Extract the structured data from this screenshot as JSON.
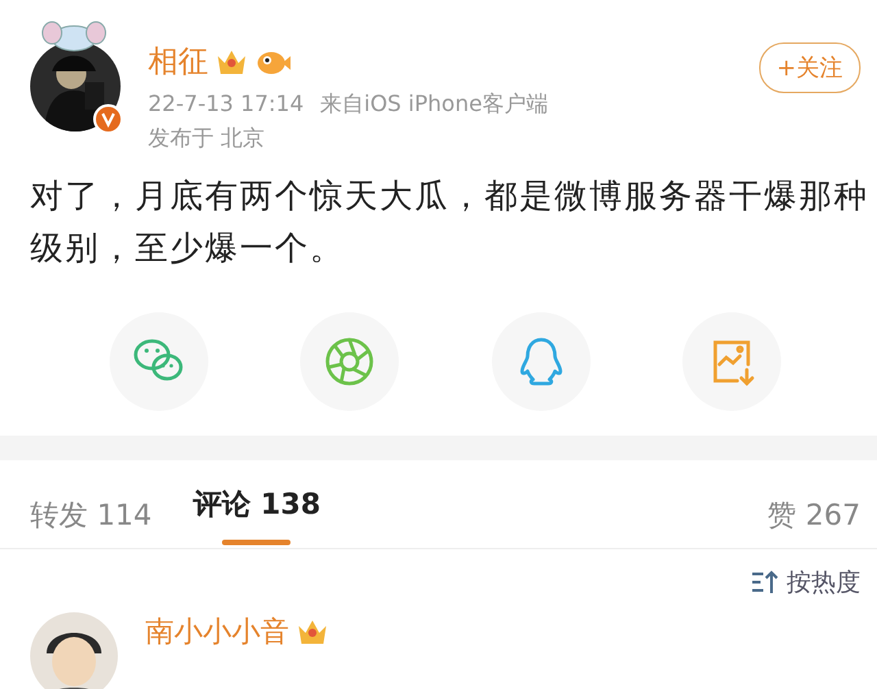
{
  "post": {
    "author": {
      "name": "相征",
      "verified": true
    },
    "time": "22-7-13 17:14",
    "source": "来自iOS iPhone客户端",
    "location": "发布于 北京",
    "follow_button": "+关注",
    "text": "对了，月底有两个惊天大瓜，都是微博服务器干爆那种级别，至少爆一个。"
  },
  "share": [
    {
      "kind": "wechat"
    },
    {
      "kind": "moments"
    },
    {
      "kind": "qq"
    },
    {
      "kind": "save-image"
    }
  ],
  "tabs": [
    {
      "label": "转发",
      "count": "114",
      "selected": false
    },
    {
      "label": "评论",
      "count": "138",
      "selected": true
    },
    {
      "label": "赞",
      "count": "267",
      "selected": false
    }
  ],
  "sort": {
    "label": "按热度"
  },
  "comments": [
    {
      "name": "南小小小音"
    }
  ]
}
